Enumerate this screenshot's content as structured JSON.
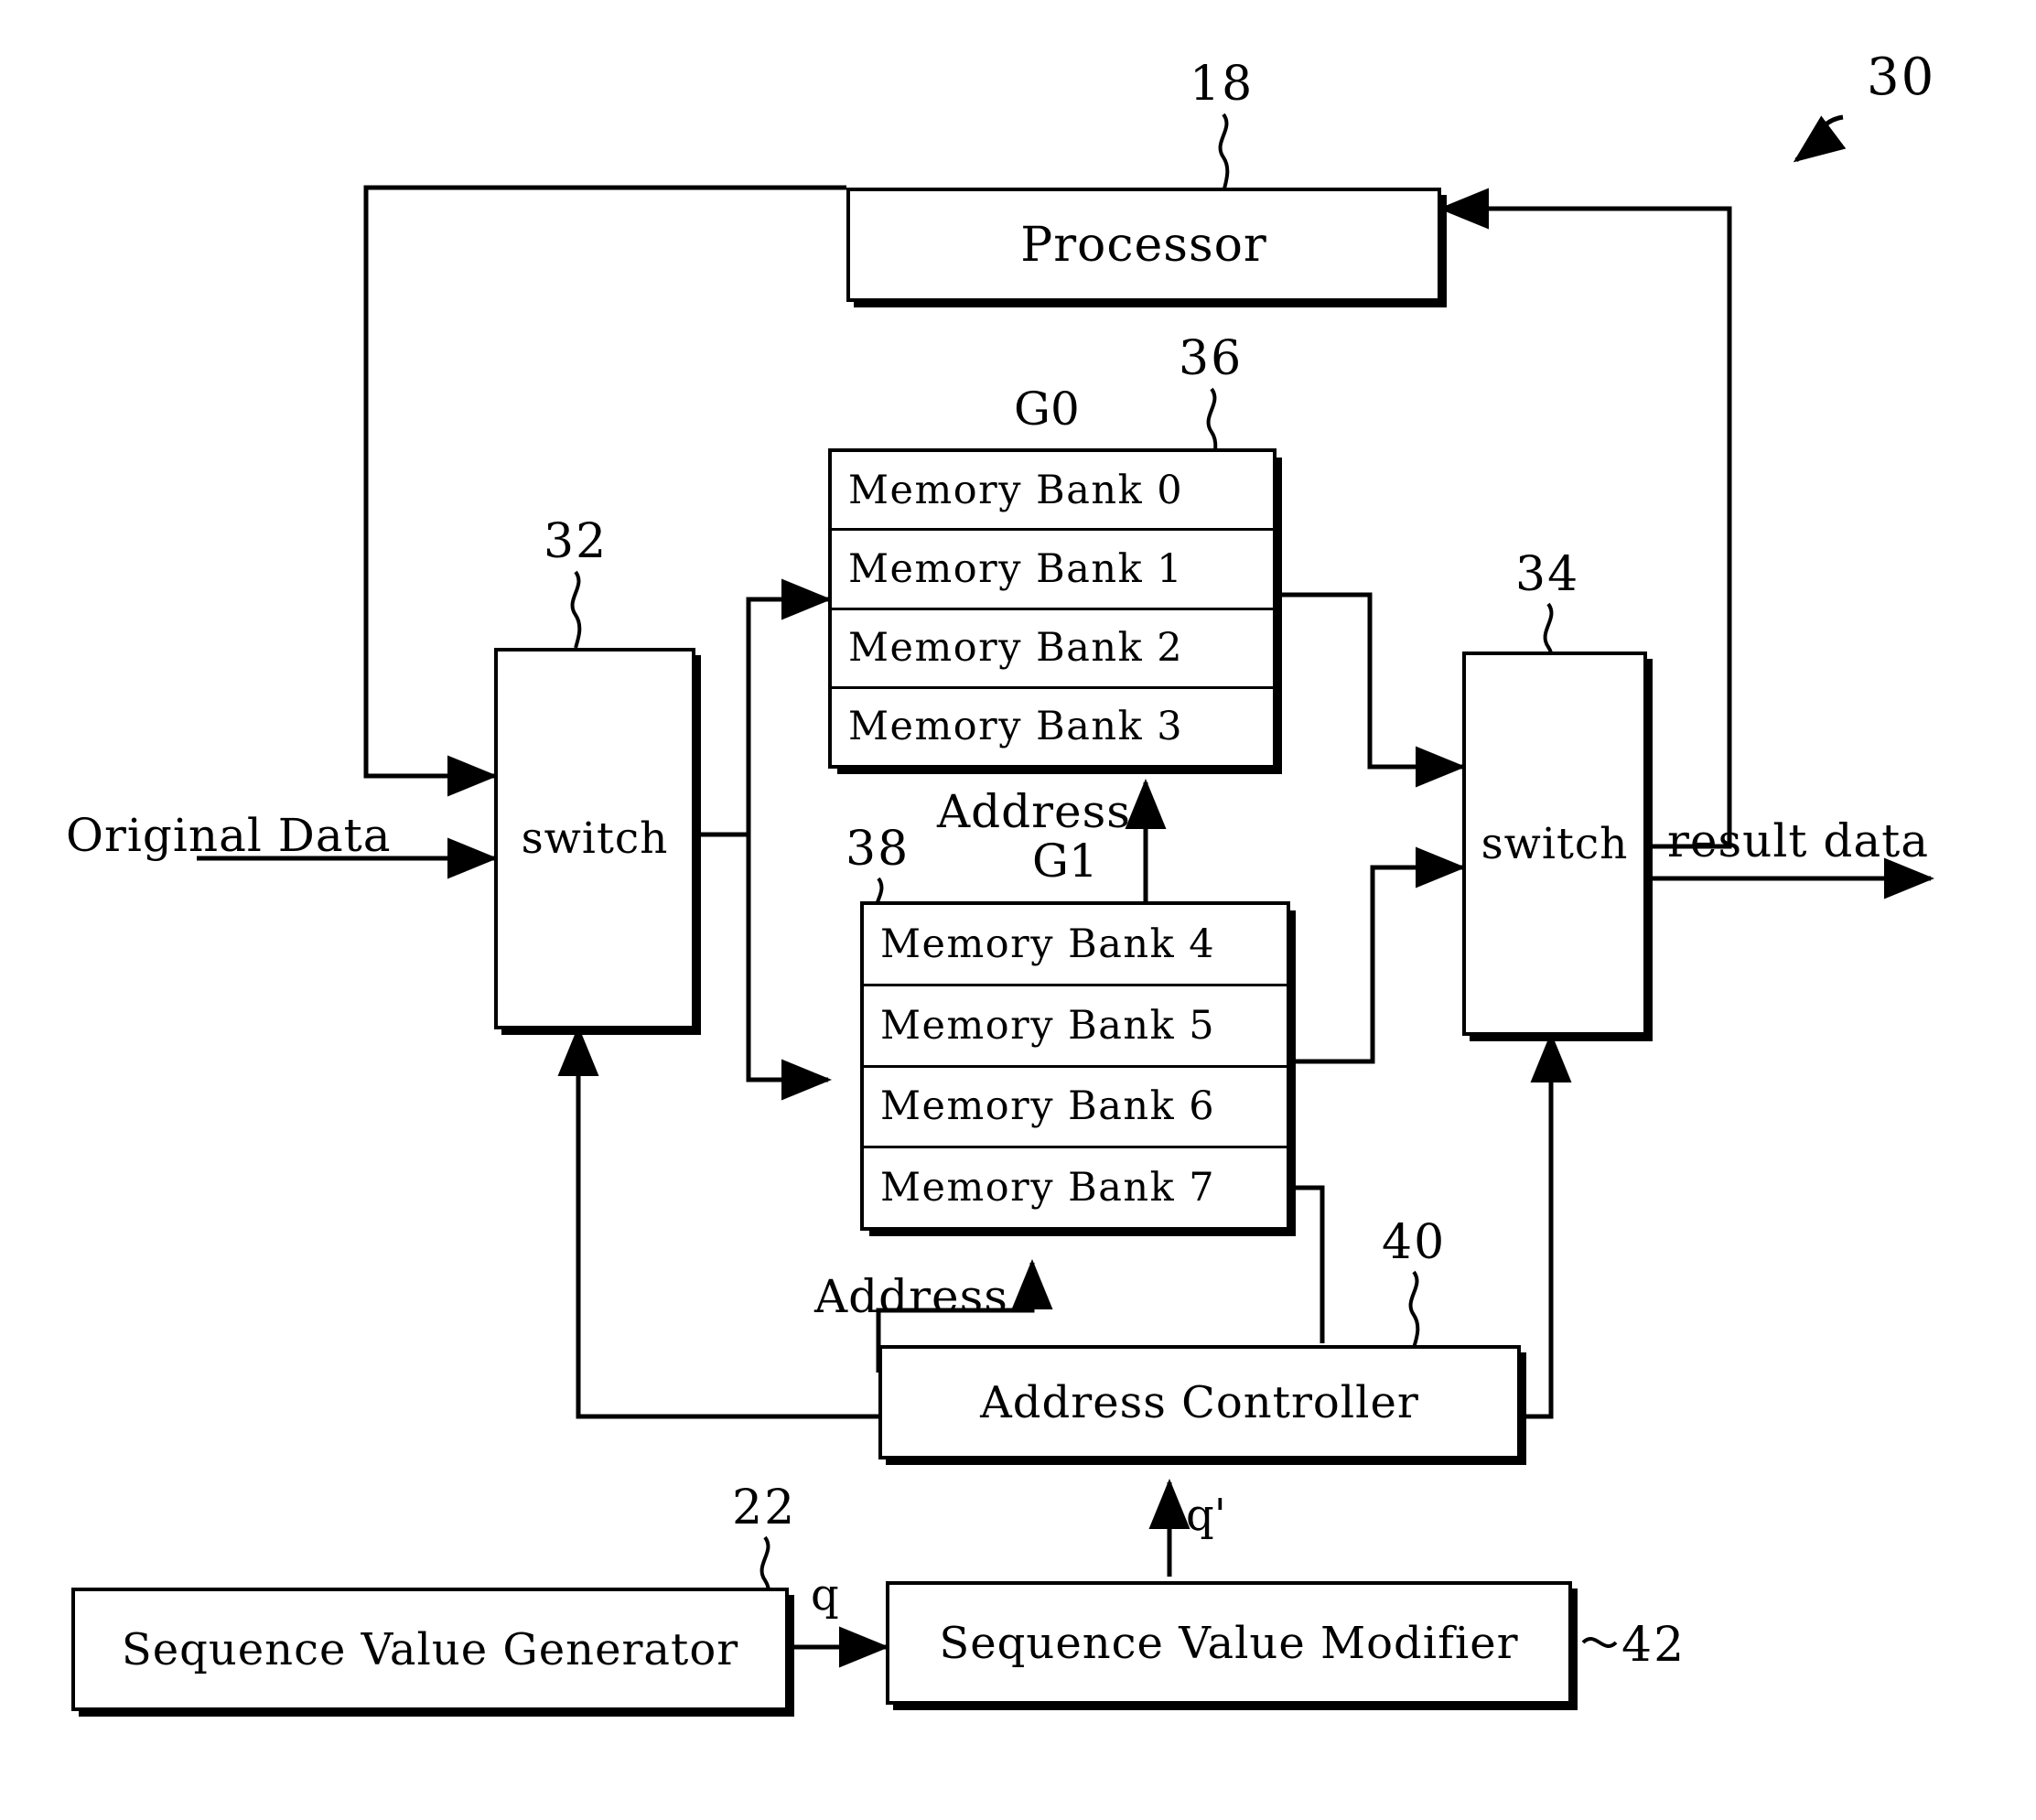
{
  "figure": {
    "number": "30",
    "background": "#ffffff",
    "ink": "#000000"
  },
  "blocks": {
    "processor": {
      "label": "Processor",
      "ref": "18"
    },
    "switch_in": {
      "label": "switch",
      "ref": "32"
    },
    "switch_out": {
      "label": "switch",
      "ref": "34"
    },
    "group0": {
      "title": "G0",
      "ref": "36"
    },
    "group1": {
      "title": "G1",
      "ref": "38"
    },
    "address_controller": {
      "label": "Address Controller",
      "ref": "40"
    },
    "sequence_generator": {
      "label": "Sequence Value Generator",
      "ref": "22"
    },
    "sequence_modifier": {
      "label": "Sequence Value Modifier",
      "ref": "42"
    }
  },
  "memory_banks": {
    "g0": [
      {
        "label": "Memory Bank 0"
      },
      {
        "label": "Memory Bank 1"
      },
      {
        "label": "Memory Bank 2"
      },
      {
        "label": "Memory Bank 3"
      }
    ],
    "g1": [
      {
        "label": "Memory Bank 4"
      },
      {
        "label": "Memory Bank 5"
      },
      {
        "label": "Memory Bank 6"
      },
      {
        "label": "Memory Bank 7"
      }
    ]
  },
  "signals": {
    "original_data": "Original Data",
    "result_data": "result data",
    "address_g0": "Address",
    "address_g1": "Address",
    "q": "q",
    "q_prime": "q'"
  }
}
